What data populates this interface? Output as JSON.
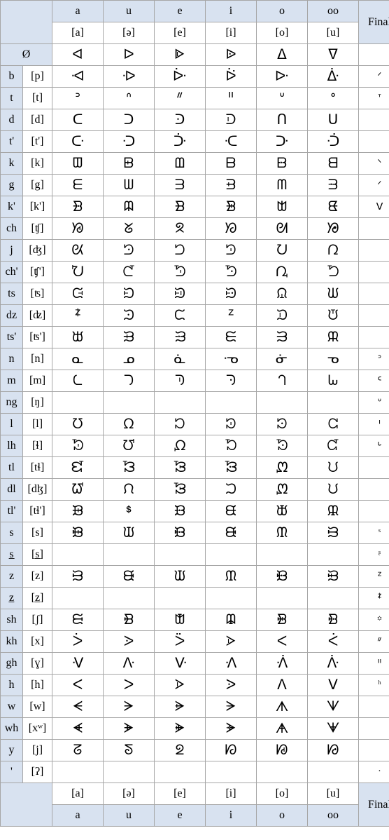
{
  "columns": {
    "vowels": [
      "a",
      "u",
      "e",
      "i",
      "o",
      "oo"
    ],
    "vowels_ipa": [
      "[a]",
      "[ə]",
      "[e]",
      "[i]",
      "[o]",
      "[u]"
    ],
    "final_label": "Final"
  },
  "first_row": {
    "label": "Ø",
    "glyphs": [
      "ᐊ",
      "ᐅ",
      "ᐈ",
      "ᐉ",
      "ᐃ",
      "ᐁ"
    ],
    "final": ""
  },
  "rows": [
    {
      "label": "b",
      "ipa": "[p]",
      "glyphs": [
        "ᐗ",
        "ᐒ",
        "ᐕ",
        "ᐖ",
        "ᐓ",
        "ᐑ"
      ],
      "final": "ᐟ"
    },
    {
      "label": "t",
      "ipa": "[t]",
      "glyphs": [
        "ᐣ",
        "ᐢ",
        "ᐥ",
        "ᐦ",
        "ᐡ",
        "ᐤ"
      ],
      "final": "ᐪ"
    },
    {
      "label": "d",
      "ipa": "[d]",
      "glyphs": [
        "ᑕ",
        "ᑐ",
        "ᑔ",
        "ᑓ",
        "ᑎ",
        "ᑌ"
      ],
      "final": ""
    },
    {
      "label": "t'",
      "ipa": "[t']",
      "glyphs": [
        "ᑢ",
        "ᑝ",
        "ᑠ",
        "ᑡ",
        "ᑞ",
        "ᑟ"
      ],
      "final": ""
    },
    {
      "label": "k",
      "ipa": "[k]",
      "glyphs": [
        "ᗵ",
        "ᗸ",
        "ᗶ",
        "ᗷ",
        "ᗹ",
        "ᗺ"
      ],
      "final": "ᐠ"
    },
    {
      "label": "g",
      "ipa": "[g]",
      "glyphs": [
        "ᗴ",
        "ᗯ",
        "ᗱ",
        "ᗲ",
        "ᗰ",
        "ᗳ"
      ],
      "final": "ᐟ"
    },
    {
      "label": "k'",
      "ipa": "[k']",
      "glyphs": [
        "ᗿ",
        "ᗼ",
        "ᗽ",
        "ᗾ",
        "ᗻ",
        "ᘀ"
      ],
      "final": "ᐯ"
    },
    {
      "label": "ch",
      "ipa": "[ʧ]",
      "glyphs": [
        "ᘟ",
        "ᘜ",
        "ᘝ",
        "ᘞ",
        "ᘛ",
        "ᘠ"
      ],
      "final": ""
    },
    {
      "label": "j",
      "ipa": "[ʤ]",
      "glyphs": [
        "ᘡ",
        "ᘦ",
        "ᘤ",
        "ᘥ",
        "ᘢ",
        "ᘣ"
      ],
      "final": ""
    },
    {
      "label": "ch'",
      "ipa": "[ʧ']",
      "glyphs": [
        "ᘨ",
        "ᘭ",
        "ᘫ",
        "ᘬ",
        "ᘩ",
        "ᘪ"
      ],
      "final": ""
    },
    {
      "label": "ts",
      "ipa": "[ʦ]",
      "glyphs": [
        "ᙍ",
        "ᙊ",
        "ᙋ",
        "ᙌ",
        "ᙉ",
        "ᙎ"
      ],
      "final": ""
    },
    {
      "label": "dz",
      "ipa": "[ʣ]",
      "glyphs": [
        "ᙇ",
        "ᙄ",
        "ᙅ",
        "ᙆ",
        "ᙃ",
        "ᙈ"
      ],
      "final": ""
    },
    {
      "label": "ts'",
      "ipa": "[ʦ']",
      "glyphs": [
        "ᙔ",
        "ᙑ",
        "ᙒ",
        "ᙓ",
        "ᙐ",
        "ᙕ"
      ],
      "final": ""
    },
    {
      "label": "n",
      "ipa": "[n]",
      "glyphs": [
        "ᓇ",
        "ᓄ",
        "ᓈ",
        "ᓉ",
        "ᓃ",
        "ᓀ"
      ],
      "final": "ᐣ"
    },
    {
      "label": "m",
      "ipa": "[m]",
      "glyphs": [
        "ᘇ",
        "ᘄ",
        "ᘅ",
        "ᘆ",
        "ᘃ",
        "ᘈ"
      ],
      "final": "ᑦ"
    },
    {
      "label": "ng",
      "ipa": "[ŋ]",
      "glyphs": [
        "",
        "",
        "",
        "",
        "",
        ""
      ],
      "final": "ᐡ"
    },
    {
      "label": "l",
      "ipa": "[l]",
      "glyphs": [
        "ᘮ",
        "ᘯ",
        "ᘰ",
        "ᘱ",
        "ᘲ",
        "ᘳ"
      ],
      "final": "ᑊ"
    },
    {
      "label": "lh",
      "ipa": "[ɬ]",
      "glyphs": [
        "ᘷ",
        "ᘴ",
        "ᘵ",
        "ᘶ",
        "ᘸ",
        "ᘹ"
      ],
      "final": "ᒡ"
    },
    {
      "label": "tl",
      "ipa": "[tɬ]",
      "glyphs": [
        "ᘿ",
        "ᘼ",
        "ᘽ",
        "ᘾ",
        "ᘻ",
        "ᙀ"
      ],
      "final": ""
    },
    {
      "label": "dl",
      "ipa": "[dɮ]",
      "glyphs": [
        "ᘺ",
        "ᙁ",
        "ᘽ",
        "ᙂ",
        "ᘻ",
        "ᙀ"
      ],
      "final": ""
    },
    {
      "label": "tl'",
      "ipa": "[tɬ']",
      "glyphs": [
        "ᙗ",
        "ᙚ",
        "ᙘ",
        "ᙙ",
        "ᙛ",
        "ᙜ"
      ],
      "final": ""
    },
    {
      "label": "s",
      "ipa": "[s]",
      "glyphs": [
        "ᙞ",
        "ᙡ",
        "ᙟ",
        "ᙠ",
        "ᙢ",
        "ᙣ"
      ],
      "final": "ˢ"
    },
    {
      "label": "s̲",
      "ipa": "[s̲]",
      "glyphs": [
        "",
        "",
        "",
        "",
        "",
        ""
      ],
      "final": "ᶳ"
    },
    {
      "label": "z",
      "ipa": "[z]",
      "glyphs": [
        "ᙣ",
        "ᙠ",
        "ᙡ",
        "ᙢ",
        "ᙟ",
        "ᙤ"
      ],
      "final": "ᙆ"
    },
    {
      "label": "z̲",
      "ipa": "[z̲]",
      "glyphs": [
        "",
        "",
        "",
        "",
        "",
        ""
      ],
      "final": "ᙇ"
    },
    {
      "label": "sh",
      "ipa": "[ʃ]",
      "glyphs": [
        "ᙦ",
        "ᙩ",
        "ᙧ",
        "ᙨ",
        "ᙪ",
        "ᙫ"
      ],
      "final": "꙳"
    },
    {
      "label": "kh",
      "ipa": "[x]",
      "glyphs": [
        "ᐴ",
        "ᐷ",
        "ᐵ",
        "ᐶ",
        "ᐸ",
        "ᐹ"
      ],
      "final": "ᐥ"
    },
    {
      "label": "gh",
      "ipa": "[ɣ]",
      "glyphs": [
        "ᐺ",
        "ᐽ",
        "ᐻ",
        "ᐼ",
        "ᐾ",
        "ᐿ"
      ],
      "final": "ᐦ"
    },
    {
      "label": "h",
      "ipa": "[h]",
      "glyphs": [
        "ᐸ",
        "ᐳ",
        "ᐶ",
        "ᐷ",
        "ᐱ",
        "ᐯ"
      ],
      "final": "ʰ"
    },
    {
      "label": "w",
      "ipa": "[w]",
      "glyphs": [
        "ᗕ",
        "ᗒ",
        "ᗓ",
        "ᗔ",
        "ᗑ",
        "ᗐ"
      ],
      "final": ""
    },
    {
      "label": "wh",
      "ipa": "[xʷ]",
      "glyphs": [
        "ᗛ",
        "ᗘ",
        "ᗙ",
        "ᗚ",
        "ᗗ",
        "ᗖ"
      ],
      "final": ""
    },
    {
      "label": "y",
      "ipa": "[j]",
      "glyphs": [
        "ᘔ",
        "ᘕ",
        "ᘖ",
        "ᘗ",
        "ᘘ",
        "ᘙ"
      ],
      "final": ""
    },
    {
      "label": "'",
      "ipa": "[ʔ]",
      "glyphs": [
        "",
        "",
        "",
        "",
        "",
        ""
      ],
      "final": "·"
    }
  ]
}
